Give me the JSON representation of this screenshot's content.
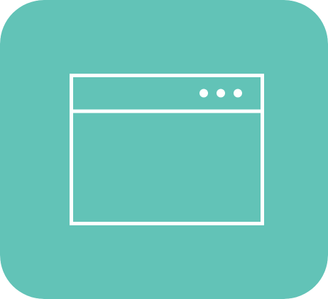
{
  "icon": {
    "semantic": "browser-window-icon",
    "background_color": "#62C3B7",
    "stroke_color": "#FFFFFF",
    "dots_count": 3
  }
}
